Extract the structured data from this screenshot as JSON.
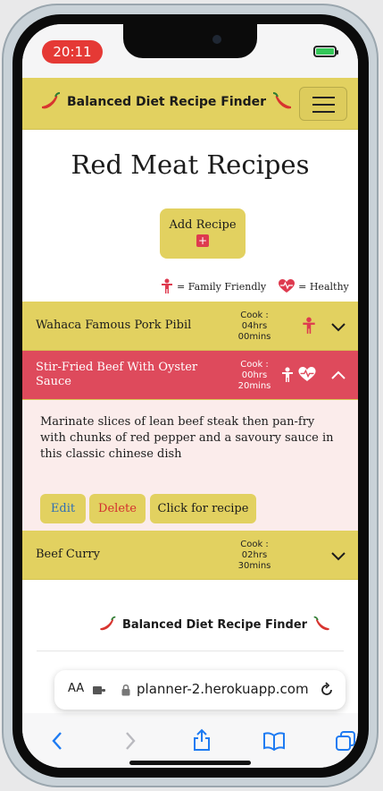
{
  "status_bar": {
    "time": "20:11"
  },
  "navbar": {
    "brand": "Balanced Diet Recipe Finder"
  },
  "page": {
    "title": "Red Meat Recipes"
  },
  "add_recipe": {
    "label": "Add Recipe",
    "plus": "+"
  },
  "legend": {
    "family_friendly": "= Family Friendly",
    "healthy": "= Healthy"
  },
  "recipes": [
    {
      "title": "Wahaca Famous Pork Pibil",
      "cook_label": "Cook :",
      "hours": "04hrs",
      "mins": "00mins",
      "family_friendly": true,
      "healthy": false,
      "expanded": false
    },
    {
      "title": "Stir-Fried Beef With Oyster",
      "title_line2": "Sauce",
      "cook_label": "Cook :",
      "hours": "00hrs",
      "mins": "20mins",
      "family_friendly": true,
      "healthy": true,
      "expanded": true,
      "description": "Marinate slices of lean beef steak then pan-fry with chunks of red pepper and a savoury sauce in this classic chinese dish",
      "actions": {
        "edit": "Edit",
        "delete": "Delete",
        "recipe": "Click for recipe"
      }
    },
    {
      "title": "Beef Curry",
      "cook_label": "Cook :",
      "hours": "02hrs",
      "mins": "30mins",
      "family_friendly": false,
      "healthy": false,
      "expanded": false
    }
  ],
  "footer": {
    "brand": "Balanced Diet Recipe Finder"
  },
  "browser": {
    "text_size": "AA",
    "url": "planner-2.herokuapp.com"
  },
  "colors": {
    "accent_yellow": "#e2d160",
    "accent_red": "#de4a5c",
    "icon_red": "#de3a4f",
    "panel_pink": "#fbeceb"
  },
  "icons": [
    "chili-pepper-icon",
    "hamburger-menu-icon",
    "family-friendly-icon",
    "heart-pulse-icon",
    "chevron-down-icon",
    "chevron-up-icon",
    "lock-icon",
    "reload-icon",
    "back-arrow-icon",
    "forward-arrow-icon",
    "share-icon",
    "bookmarks-icon",
    "tabs-icon",
    "extension-icon"
  ]
}
